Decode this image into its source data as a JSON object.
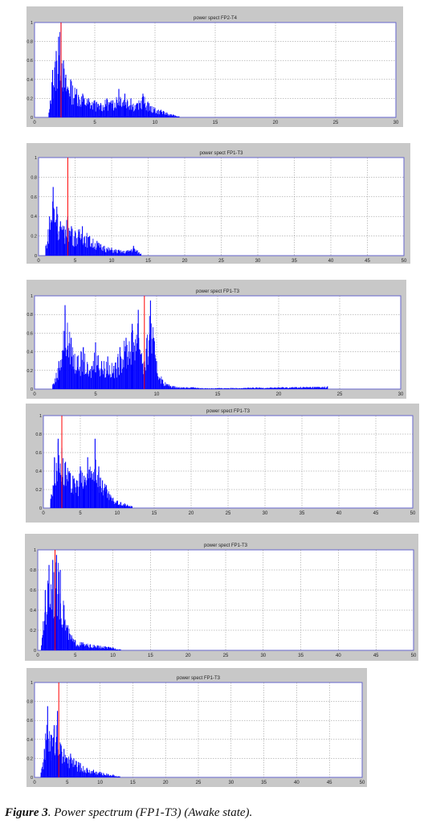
{
  "chart_data": [
    {
      "type": "area",
      "title": "power spect FP2-T4",
      "xlim": [
        0,
        30
      ],
      "ylim": [
        0,
        1
      ],
      "xticks": [
        0,
        5,
        10,
        15,
        20,
        25,
        30
      ],
      "yticks": [
        0,
        0.2,
        0.4,
        0.6,
        0.8,
        1
      ],
      "ytick_labels": [
        "0",
        "0.2",
        "0.4",
        "0.6",
        "0.8",
        "1"
      ],
      "grid": true,
      "marker_x": 2.2,
      "series": [
        {
          "color": "#0000ff",
          "x": [
            1.2,
            1.5,
            1.8,
            2.0,
            2.2,
            2.4,
            2.6,
            3.0,
            3.5,
            4.0,
            4.5,
            5.0,
            5.5,
            6.0,
            6.5,
            7.0,
            7.5,
            8.0,
            8.5,
            9.0,
            9.5,
            10.0,
            10.5,
            11.0,
            11.5,
            12.0
          ],
          "y": [
            0.05,
            0.5,
            0.7,
            0.85,
            1.0,
            0.6,
            0.45,
            0.4,
            0.3,
            0.25,
            0.2,
            0.18,
            0.15,
            0.2,
            0.18,
            0.3,
            0.25,
            0.2,
            0.15,
            0.25,
            0.15,
            0.1,
            0.08,
            0.05,
            0.03,
            0.01
          ]
        }
      ]
    },
    {
      "type": "area",
      "title": "power spect FP1-T3",
      "xlim": [
        0,
        50
      ],
      "ylim": [
        0,
        1
      ],
      "xticks": [
        0,
        5,
        10,
        15,
        20,
        25,
        30,
        35,
        40,
        45,
        50
      ],
      "yticks": [
        0,
        0.2,
        0.4,
        0.6,
        0.8,
        1
      ],
      "ytick_labels": [
        "0",
        "0.2",
        "0.4",
        "0.6",
        "0.8",
        "1"
      ],
      "grid": true,
      "marker_x": 4,
      "series": [
        {
          "color": "#0000ff",
          "x": [
            1.0,
            1.5,
            2.0,
            2.5,
            3.0,
            3.5,
            4.0,
            4.5,
            5.0,
            6.0,
            7.0,
            8.0,
            9.0,
            10.0,
            11.0,
            12.0,
            13.0,
            14.0
          ],
          "y": [
            0.1,
            0.4,
            0.7,
            0.5,
            0.35,
            0.3,
            0.4,
            0.3,
            0.25,
            0.3,
            0.2,
            0.15,
            0.1,
            0.08,
            0.06,
            0.05,
            0.1,
            0.02
          ]
        }
      ]
    },
    {
      "type": "area",
      "title": "power spect FP1-T3",
      "xlim": [
        0,
        30
      ],
      "ylim": [
        0,
        1
      ],
      "xticks": [
        0,
        5,
        10,
        15,
        20,
        25,
        30
      ],
      "yticks": [
        0,
        0.2,
        0.4,
        0.6,
        0.8,
        1
      ],
      "ytick_labels": [
        "0",
        "0.2",
        "0.4",
        "0.6",
        "0.8",
        "1"
      ],
      "grid": true,
      "marker_x": 9,
      "series": [
        {
          "color": "#0000ff",
          "x": [
            1.5,
            2.0,
            2.5,
            3.0,
            3.5,
            4.0,
            4.5,
            5.0,
            5.5,
            6.0,
            6.5,
            7.0,
            7.5,
            8.0,
            8.5,
            9.0,
            9.5,
            10.0,
            10.5,
            11.0,
            11.5,
            12.0,
            12.5,
            13.0,
            14.0,
            24.0
          ],
          "y": [
            0.05,
            0.3,
            0.9,
            0.55,
            0.35,
            0.45,
            0.2,
            0.5,
            0.3,
            0.35,
            0.25,
            0.45,
            0.55,
            0.7,
            0.85,
            0.3,
            0.95,
            0.3,
            0.1,
            0.05,
            0.03,
            0.02,
            0.02,
            0.02,
            0.01,
            0.03
          ]
        }
      ]
    },
    {
      "type": "area",
      "title": "power spect FP1-T3",
      "xlim": [
        0,
        50
      ],
      "ylim": [
        0,
        1
      ],
      "xticks": [
        0,
        5,
        10,
        15,
        20,
        25,
        30,
        35,
        40,
        45,
        50
      ],
      "yticks": [
        0,
        0.2,
        0.4,
        0.6,
        0.8,
        1
      ],
      "ytick_labels": [
        "0",
        "0.2",
        "0.4",
        "0.6",
        "0.8",
        "1"
      ],
      "grid": true,
      "marker_x": 2.5,
      "series": [
        {
          "color": "#0000ff",
          "x": [
            1.0,
            1.5,
            2.0,
            2.5,
            3.0,
            3.5,
            4.0,
            4.5,
            5.0,
            5.5,
            6.0,
            6.5,
            7.0,
            7.5,
            8.0,
            8.5,
            9.0,
            10.0,
            11.0,
            12.0
          ],
          "y": [
            0.1,
            0.55,
            0.75,
            0.65,
            0.5,
            0.4,
            0.35,
            0.3,
            0.45,
            0.35,
            0.55,
            0.4,
            0.75,
            0.45,
            0.3,
            0.25,
            0.15,
            0.08,
            0.05,
            0.02
          ]
        }
      ]
    },
    {
      "type": "area",
      "title": "power spect FP1-T3",
      "xlim": [
        0,
        50
      ],
      "ylim": [
        0,
        1
      ],
      "xticks": [
        0,
        5,
        10,
        15,
        20,
        25,
        30,
        35,
        40,
        45,
        50
      ],
      "yticks": [
        0,
        0.2,
        0.4,
        0.6,
        0.8,
        1
      ],
      "ytick_labels": [
        "0",
        "0.2",
        "0.4",
        "0.6",
        "0.8",
        "1"
      ],
      "grid": true,
      "marker_x": 2.3,
      "series": [
        {
          "color": "#0000ff",
          "x": [
            0.5,
            1.0,
            1.5,
            2.0,
            2.5,
            3.0,
            3.5,
            4.0,
            4.5,
            5.0,
            6.0,
            7.0,
            8.0,
            9.0,
            10.0,
            11.0
          ],
          "y": [
            0.05,
            0.6,
            0.85,
            0.9,
            0.95,
            0.8,
            0.45,
            0.25,
            0.15,
            0.1,
            0.08,
            0.06,
            0.05,
            0.04,
            0.03,
            0.01
          ]
        }
      ]
    },
    {
      "type": "area",
      "title": "power spect FP1-T3",
      "xlim": [
        0,
        50
      ],
      "ylim": [
        0,
        1
      ],
      "xticks": [
        0,
        5,
        10,
        15,
        20,
        25,
        30,
        35,
        40,
        45,
        50
      ],
      "yticks": [
        0,
        0.2,
        0.4,
        0.6,
        0.8,
        1
      ],
      "ytick_labels": [
        "0",
        "0.2",
        "0.4",
        "0.6",
        "0.8",
        "1"
      ],
      "grid": true,
      "marker_x": 3.7,
      "series": [
        {
          "color": "#0000ff",
          "x": [
            1.0,
            1.5,
            2.0,
            2.5,
            3.0,
            3.5,
            4.0,
            4.5,
            5.0,
            5.5,
            6.0,
            7.0,
            8.0,
            9.0,
            10.0,
            11.0,
            12.0,
            13.0
          ],
          "y": [
            0.05,
            0.3,
            0.75,
            0.45,
            0.55,
            0.7,
            0.35,
            0.3,
            0.2,
            0.25,
            0.2,
            0.15,
            0.1,
            0.08,
            0.06,
            0.04,
            0.03,
            0.01
          ]
        }
      ]
    }
  ],
  "caption": {
    "label": "Figure 3",
    "text": ". Power spectrum (FP1-T3) (Awake state)."
  }
}
